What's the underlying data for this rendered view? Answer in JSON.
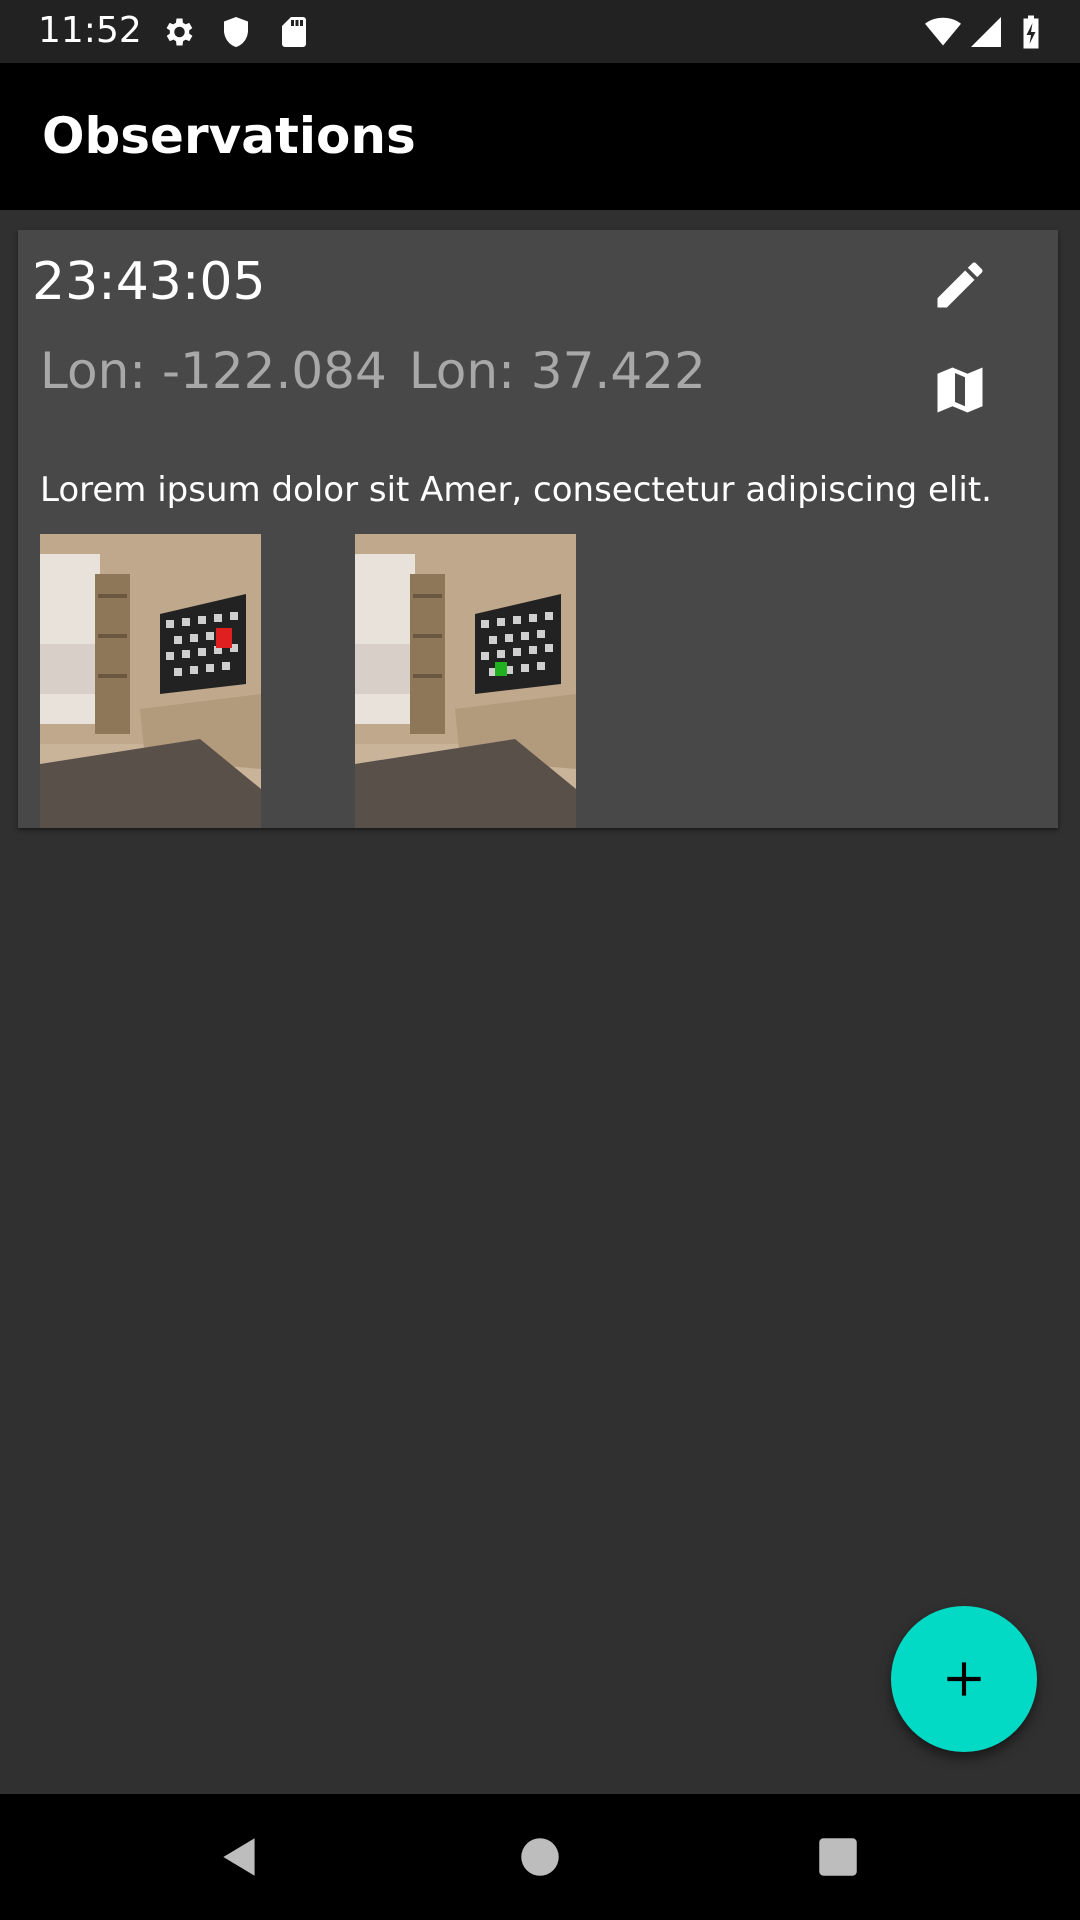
{
  "status_bar": {
    "time": "11:52",
    "icons": [
      "settings-icon",
      "shield-icon",
      "sd-card-icon",
      "wifi-icon",
      "signal-icon",
      "battery-charging-icon"
    ]
  },
  "app_bar": {
    "title": "Observations"
  },
  "observation": {
    "time": "23:43:05",
    "lon_label": "Lon: -122.084",
    "lat_label": "Lon: 37.422",
    "description": "Lorem ipsum dolor sit Amer, consectetur adipiscing elit.",
    "actions": [
      "edit-icon",
      "map-icon"
    ],
    "photos": [
      {
        "marker_color": "#e02020"
      },
      {
        "marker_color": "#20b020"
      }
    ]
  },
  "fab": {
    "icon": "plus-icon",
    "color": "#03dac5"
  },
  "nav_bar": {
    "buttons": [
      "back-icon",
      "home-icon",
      "recents-icon"
    ]
  }
}
